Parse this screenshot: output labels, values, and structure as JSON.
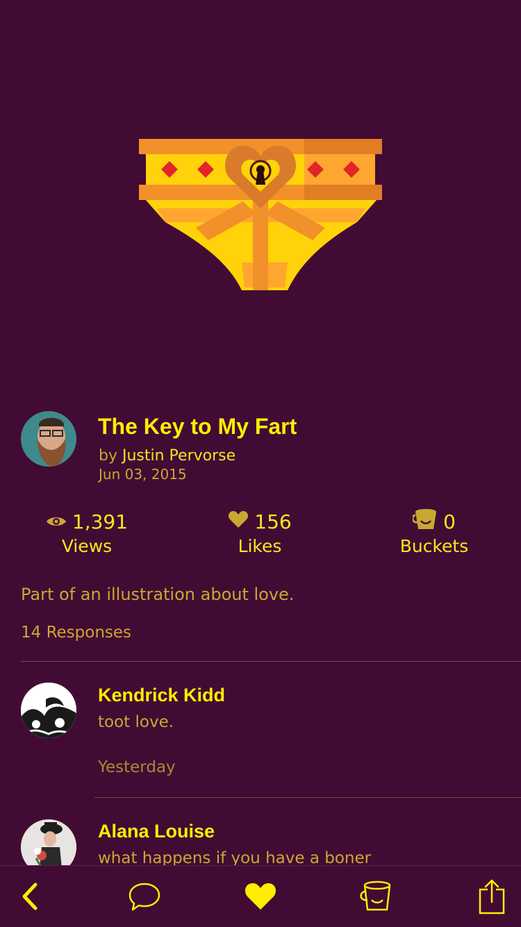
{
  "shot": {
    "title": "The Key to My Fart",
    "by_prefix": "by",
    "author": "Justin Pervorse",
    "date": "Jun 03, 2015",
    "description": "Part of an illustration about love."
  },
  "stats": {
    "views": {
      "value": "1,391",
      "label": "Views",
      "icon": "eye-icon"
    },
    "likes": {
      "value": "156",
      "label": "Likes",
      "icon": "heart-icon"
    },
    "buckets": {
      "value": "0",
      "label": "Buckets",
      "icon": "bucket-icon"
    }
  },
  "responses_label": "14 Responses",
  "comments": [
    {
      "name": "Kendrick Kidd",
      "text": "toot love.",
      "time": "Yesterday"
    },
    {
      "name": "Alana Louise",
      "text": "what happens if you have a boner"
    }
  ],
  "tabbar": {
    "items": [
      "back-icon",
      "comment-icon",
      "heart-icon",
      "bucket-icon",
      "share-icon"
    ]
  },
  "colors": {
    "background": "#420b34",
    "accent": "#ffee00",
    "muted_text": "#c9a832"
  }
}
